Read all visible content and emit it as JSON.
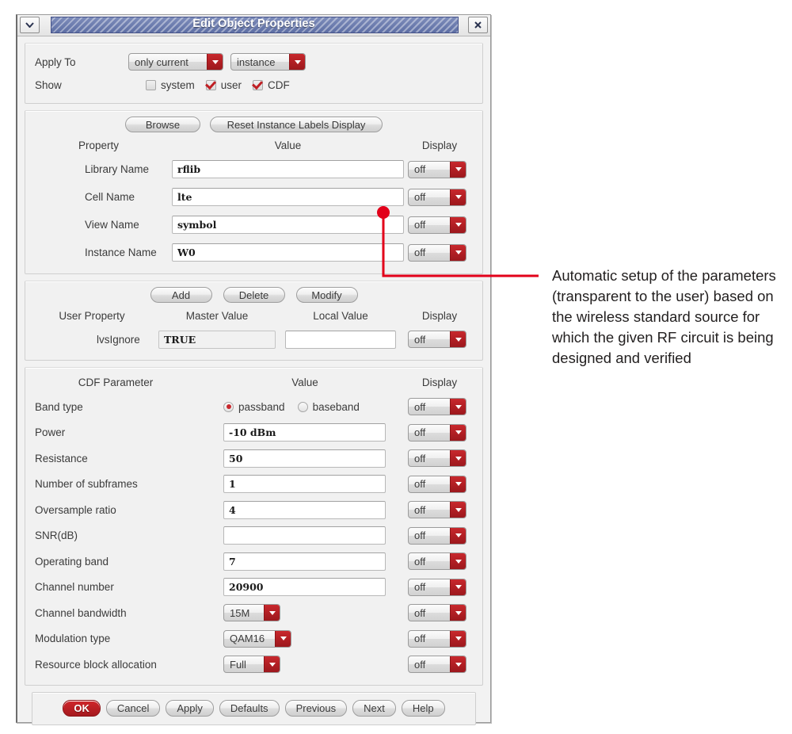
{
  "window": {
    "title": "Edit Object Properties",
    "menu_icon": "chevron-down-icon",
    "close_icon": "close-icon"
  },
  "apply_section": {
    "apply_to_label": "Apply To",
    "scope_dropdown": "only current",
    "object_dropdown": "instance",
    "show_label": "Show",
    "checkboxes": [
      {
        "label": "system",
        "checked": false
      },
      {
        "label": "user",
        "checked": true
      },
      {
        "label": "CDF",
        "checked": true
      }
    ]
  },
  "property_section": {
    "browse_button": "Browse",
    "reset_button": "Reset Instance Labels Display",
    "headers": {
      "property": "Property",
      "value": "Value",
      "display": "Display"
    },
    "rows": [
      {
        "name": "Library Name",
        "value": "rflib",
        "display": "off"
      },
      {
        "name": "Cell Name",
        "value": "lte",
        "display": "off"
      },
      {
        "name": "View Name",
        "value": "symbol",
        "display": "off"
      },
      {
        "name": "Instance Name",
        "value": "W0",
        "display": "off"
      }
    ]
  },
  "user_property_section": {
    "add_button": "Add",
    "delete_button": "Delete",
    "modify_button": "Modify",
    "headers": {
      "user_property": "User Property",
      "master_value": "Master Value",
      "local_value": "Local Value",
      "display": "Display"
    },
    "rows": [
      {
        "name": "lvsIgnore",
        "master_value": "TRUE",
        "local_value": "",
        "display": "off"
      }
    ]
  },
  "cdf_section": {
    "headers": {
      "parameter": "CDF Parameter",
      "value": "Value",
      "display": "Display"
    },
    "rows": [
      {
        "name": "Band type",
        "type": "radio",
        "options": [
          {
            "label": "passband",
            "selected": true
          },
          {
            "label": "baseband",
            "selected": false
          }
        ],
        "display": "off"
      },
      {
        "name": "Power",
        "type": "text",
        "value": "-10    dBm",
        "display": "off"
      },
      {
        "name": "Resistance",
        "type": "text",
        "value": "50",
        "display": "off"
      },
      {
        "name": "Number of subframes",
        "type": "text",
        "value": "1",
        "display": "off"
      },
      {
        "name": "Oversample ratio",
        "type": "text",
        "value": "4",
        "display": "off"
      },
      {
        "name": "SNR(dB)",
        "type": "text",
        "value": "",
        "display": "off"
      },
      {
        "name": "Operating band",
        "type": "text",
        "value": "7",
        "display": "off"
      },
      {
        "name": "Channel number",
        "type": "text",
        "value": "20900",
        "display": "off"
      },
      {
        "name": "Channel bandwidth",
        "type": "select",
        "value": "15M",
        "display": "off"
      },
      {
        "name": "Modulation type",
        "type": "select",
        "value": "QAM16",
        "display": "off"
      },
      {
        "name": "Resource block allocation",
        "type": "select",
        "value": "Full",
        "display": "off"
      }
    ]
  },
  "button_bar": {
    "buttons": [
      {
        "label": "OK",
        "primary": true
      },
      {
        "label": "Cancel",
        "primary": false
      },
      {
        "label": "Apply",
        "primary": false
      },
      {
        "label": "Defaults",
        "primary": false
      },
      {
        "label": "Previous",
        "primary": false
      },
      {
        "label": "Next",
        "primary": false
      },
      {
        "label": "Help",
        "primary": false
      }
    ]
  },
  "annotation": {
    "text": "Automatic setup of the parameters (transparent to the user) based on the wireless standard source for which the given RF circuit is being designed and verified",
    "accent_color": "#e2001a"
  }
}
